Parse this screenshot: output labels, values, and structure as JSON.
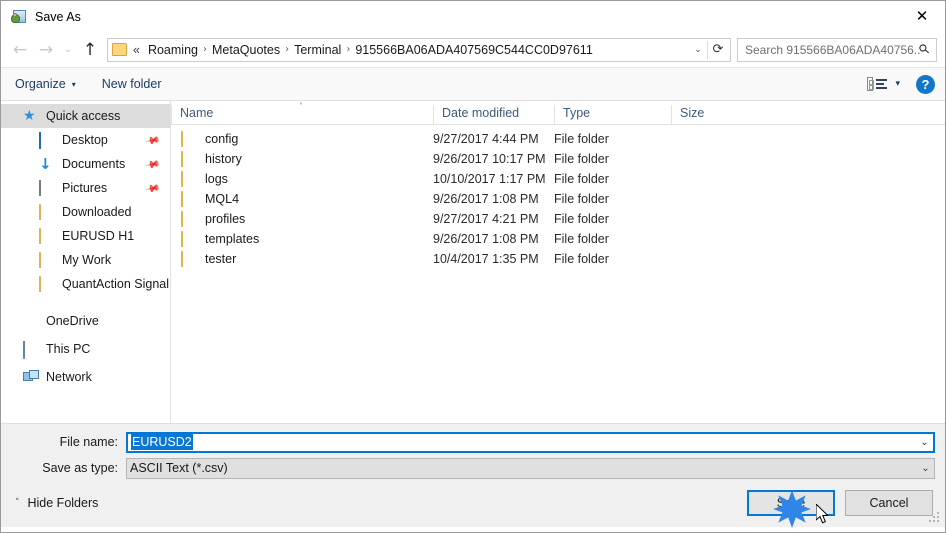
{
  "window": {
    "title": "Save As",
    "title_icon": "save-as-icon",
    "close_label": "✕"
  },
  "nav": {
    "back": "←",
    "forward": "→",
    "recent": "⌄",
    "up": "↑",
    "folder_icon": "folder-icon",
    "breadcrumb_lead": "«",
    "breadcrumbs": [
      "Roaming",
      "MetaQuotes",
      "Terminal",
      "915566BA06ADA407569C544CC0D97611"
    ],
    "separator": "›",
    "dropdown_caret": "⌄",
    "refresh": "⟳"
  },
  "search": {
    "placeholder": "Search 915566BA06ADA40756...",
    "icon": "search-icon"
  },
  "toolbar": {
    "organize_label": "Organize",
    "organize_caret": "▾",
    "new_folder_label": "New folder",
    "view_icon": "view-mode-icon",
    "view_caret": "▾",
    "help_label": "?"
  },
  "sidebar": {
    "items": [
      {
        "label": "Quick access",
        "icon": "star-icon",
        "selected": true,
        "level": "root",
        "pinned": false
      },
      {
        "label": "Desktop",
        "icon": "desktop-icon",
        "selected": false,
        "level": "child",
        "pinned": true
      },
      {
        "label": "Documents",
        "icon": "documents-icon",
        "selected": false,
        "level": "child",
        "pinned": true
      },
      {
        "label": "Pictures",
        "icon": "pictures-icon",
        "selected": false,
        "level": "child",
        "pinned": true
      },
      {
        "label": "Downloaded",
        "icon": "folder-icon",
        "selected": false,
        "level": "child",
        "pinned": false
      },
      {
        "label": "EURUSD H1",
        "icon": "folder-icon",
        "selected": false,
        "level": "child",
        "pinned": false
      },
      {
        "label": "My Work",
        "icon": "folder-icon",
        "selected": false,
        "level": "child",
        "pinned": false
      },
      {
        "label": "QuantAction Signal",
        "icon": "folder-icon",
        "selected": false,
        "level": "child",
        "pinned": false
      },
      {
        "label": "OneDrive",
        "icon": "onedrive-icon",
        "selected": false,
        "level": "root",
        "pinned": false
      },
      {
        "label": "This PC",
        "icon": "this-pc-icon",
        "selected": false,
        "level": "root",
        "pinned": false
      },
      {
        "label": "Network",
        "icon": "network-icon",
        "selected": false,
        "level": "root",
        "pinned": false
      }
    ],
    "pin_glyph": "✒"
  },
  "filelist": {
    "sort_indicator": "˄",
    "columns": [
      "Name",
      "Date modified",
      "Type",
      "Size"
    ],
    "rows": [
      {
        "name": "config",
        "date": "9/27/2017 4:44 PM",
        "type": "File folder",
        "size": ""
      },
      {
        "name": "history",
        "date": "9/26/2017 10:17 PM",
        "type": "File folder",
        "size": ""
      },
      {
        "name": "logs",
        "date": "10/10/2017 1:17 PM",
        "type": "File folder",
        "size": ""
      },
      {
        "name": "MQL4",
        "date": "9/26/2017 1:08 PM",
        "type": "File folder",
        "size": ""
      },
      {
        "name": "profiles",
        "date": "9/27/2017 4:21 PM",
        "type": "File folder",
        "size": ""
      },
      {
        "name": "templates",
        "date": "9/26/2017 1:08 PM",
        "type": "File folder",
        "size": ""
      },
      {
        "name": "tester",
        "date": "10/4/2017 1:35 PM",
        "type": "File folder",
        "size": ""
      }
    ]
  },
  "form": {
    "filename_label": "File name:",
    "filename_value": "EURUSD2",
    "filetype_label": "Save as type:",
    "filetype_value": "ASCII Text (*.csv)",
    "caret": "⌄"
  },
  "footer": {
    "hide_folders_label": "Hide Folders",
    "hide_folders_caret": "˄",
    "save_label": "Save",
    "cancel_label": "Cancel"
  },
  "colors": {
    "accent": "#0078d7",
    "selection": "#0b77d4",
    "sidebar_selected": "#dcdcdc",
    "column_header_text": "#3f5a77",
    "toolbar_text": "#1b3d66",
    "folder_yellow": "#fcd881",
    "help_blue": "#1476c6",
    "burst_blue": "#2f86e8"
  }
}
